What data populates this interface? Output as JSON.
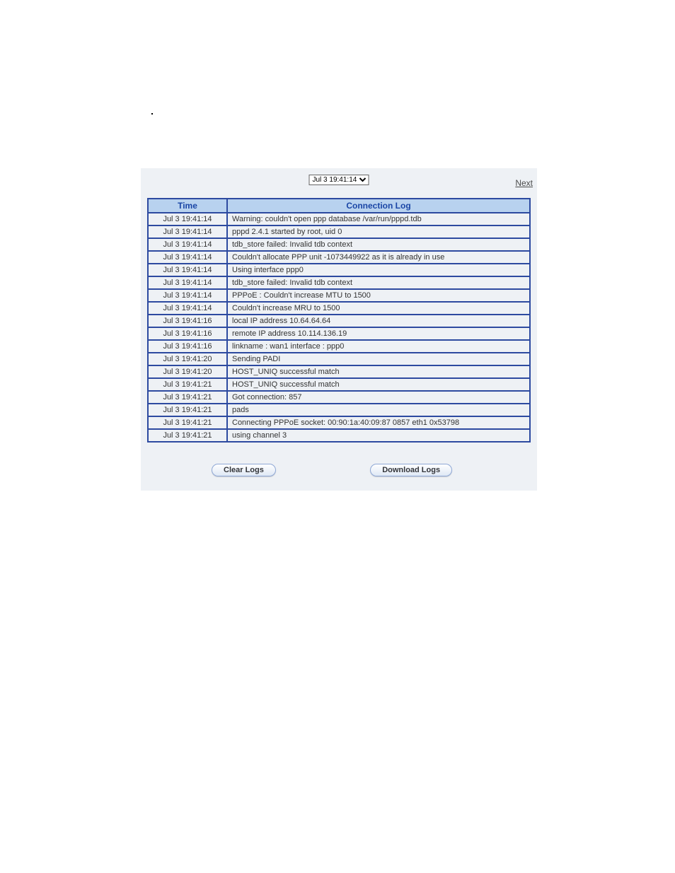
{
  "timestamp_selector": {
    "selected": "Jul 3 19:41:14",
    "options": [
      "Jul 3 19:41:14"
    ]
  },
  "nav": {
    "next": "Next"
  },
  "table": {
    "headers": {
      "time": "Time",
      "log": "Connection Log"
    },
    "rows": [
      {
        "time": "Jul 3 19:41:14",
        "msg": "Warning: couldn't open ppp database /var/run/pppd.tdb"
      },
      {
        "time": "Jul 3 19:41:14",
        "msg": "pppd 2.4.1 started by root, uid 0"
      },
      {
        "time": "Jul 3 19:41:14",
        "msg": "tdb_store failed: Invalid tdb context"
      },
      {
        "time": "Jul 3 19:41:14",
        "msg": "Couldn't allocate PPP unit -1073449922 as it is already in use"
      },
      {
        "time": "Jul 3 19:41:14",
        "msg": "Using interface ppp0"
      },
      {
        "time": "Jul 3 19:41:14",
        "msg": "tdb_store failed: Invalid tdb context"
      },
      {
        "time": "Jul 3 19:41:14",
        "msg": "PPPoE : Couldn't increase MTU to 1500"
      },
      {
        "time": "Jul 3 19:41:14",
        "msg": "Couldn't increase MRU to 1500"
      },
      {
        "time": "Jul 3 19:41:16",
        "msg": "local IP address 10.64.64.64"
      },
      {
        "time": "Jul 3 19:41:16",
        "msg": "remote IP address 10.114.136.19"
      },
      {
        "time": "Jul 3 19:41:16",
        "msg": "linkname : wan1 interface : ppp0"
      },
      {
        "time": "Jul 3 19:41:20",
        "msg": "Sending PADI"
      },
      {
        "time": "Jul 3 19:41:20",
        "msg": "HOST_UNIQ successful match"
      },
      {
        "time": "Jul 3 19:41:21",
        "msg": "HOST_UNIQ successful match"
      },
      {
        "time": "Jul 3 19:41:21",
        "msg": "Got connection: 857"
      },
      {
        "time": "Jul 3 19:41:21",
        "msg": "pads"
      },
      {
        "time": "Jul 3 19:41:21",
        "msg": "Connecting PPPoE socket: 00:90:1a:40:09:87 0857 eth1 0x53798"
      },
      {
        "time": "Jul 3 19:41:21",
        "msg": "using channel 3"
      }
    ]
  },
  "buttons": {
    "clear": "Clear Logs",
    "download": "Download Logs"
  }
}
